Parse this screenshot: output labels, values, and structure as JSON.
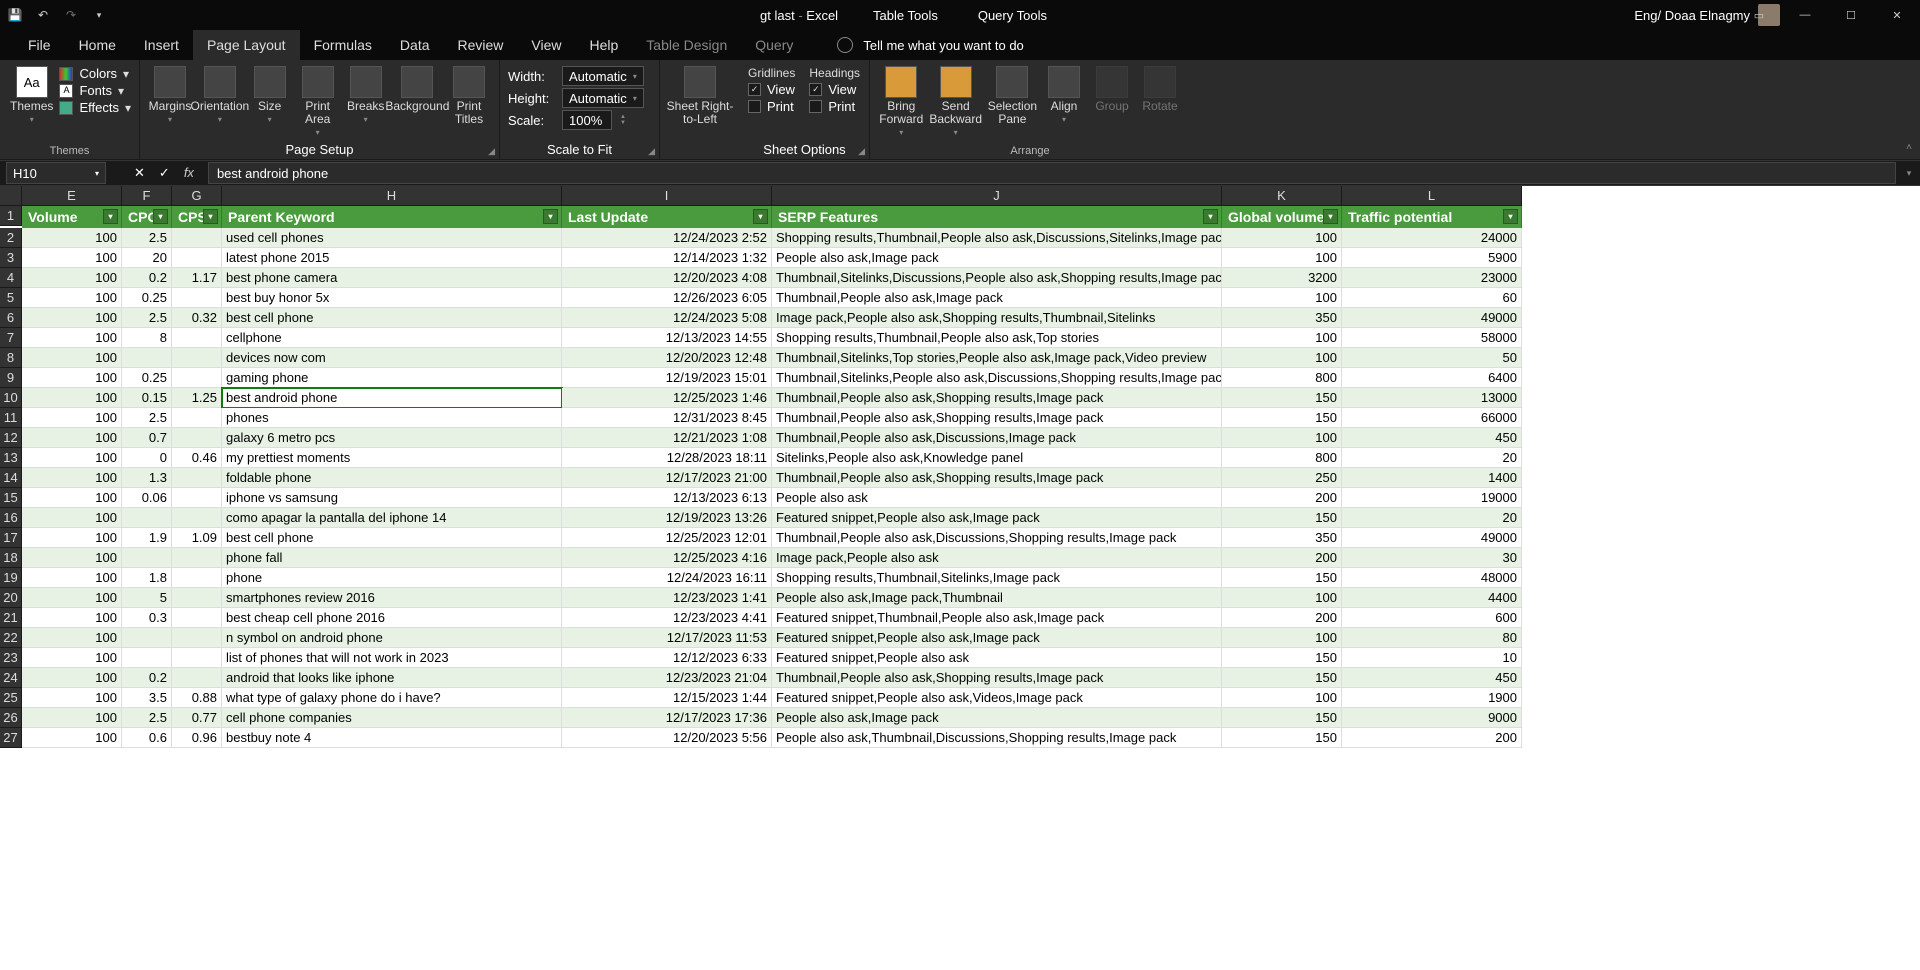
{
  "titlebar": {
    "tool_tabs": [
      "Table Tools",
      "Query Tools"
    ],
    "doc": "gt last",
    "app": "Excel",
    "user": "Eng/ Doaa Elnagmy"
  },
  "tabs": {
    "items": [
      "File",
      "Home",
      "Insert",
      "Page Layout",
      "Formulas",
      "Data",
      "Review",
      "View",
      "Help",
      "Table Design",
      "Query"
    ],
    "active": "Page Layout",
    "dim": [
      "Table Design",
      "Query"
    ],
    "tell_me": "Tell me what you want to do"
  },
  "ribbon": {
    "themes": {
      "label": "Themes",
      "themes": "Themes",
      "colors": "Colors",
      "fonts": "Fonts",
      "effects": "Effects"
    },
    "page_setup": {
      "label": "Page Setup",
      "margins": "Margins",
      "orientation": "Orientation",
      "size": "Size",
      "print_area": "Print\nArea",
      "breaks": "Breaks",
      "background": "Background",
      "print_titles": "Print\nTitles"
    },
    "scale": {
      "label": "Scale to Fit",
      "width": "Width:",
      "height": "Height:",
      "scale": "Scale:",
      "auto": "Automatic",
      "pct": "100%"
    },
    "sheet_rtl": "Sheet Right-\nto-Left",
    "sheet_options": {
      "label": "Sheet Options",
      "gridlines": "Gridlines",
      "headings": "Headings",
      "view": "View",
      "print": "Print"
    },
    "arrange": {
      "label": "Arrange",
      "bring_forward": "Bring\nForward",
      "send_backward": "Send\nBackward",
      "selection_pane": "Selection\nPane",
      "align": "Align",
      "group": "Group",
      "rotate": "Rotate"
    }
  },
  "formula_bar": {
    "cell_ref": "H10",
    "value": "best android phone"
  },
  "columns": [
    "E",
    "F",
    "G",
    "H",
    "I",
    "J",
    "K",
    "L"
  ],
  "headers": [
    "Volume",
    "CPC",
    "CPS",
    "Parent Keyword",
    "Last Update",
    "SERP Features",
    "Global volume",
    "Traffic potential"
  ],
  "rows": [
    {
      "n": 2,
      "vol": 100,
      "cpc": "2.5",
      "cps": "",
      "kw": "used cell phones",
      "upd": "12/24/2023 2:52",
      "serp": "Shopping results,Thumbnail,People also ask,Discussions,Sitelinks,Image pack",
      "gv": 100,
      "tp": 24000
    },
    {
      "n": 3,
      "vol": 100,
      "cpc": "20",
      "cps": "",
      "kw": "latest phone 2015",
      "upd": "12/14/2023 1:32",
      "serp": "People also ask,Image pack",
      "gv": 100,
      "tp": 5900
    },
    {
      "n": 4,
      "vol": 100,
      "cpc": "0.2",
      "cps": "1.17",
      "kw": "best phone camera",
      "upd": "12/20/2023 4:08",
      "serp": "Thumbnail,Sitelinks,Discussions,People also ask,Shopping results,Image pack",
      "gv": 3200,
      "tp": 23000
    },
    {
      "n": 5,
      "vol": 100,
      "cpc": "0.25",
      "cps": "",
      "kw": "best buy honor 5x",
      "upd": "12/26/2023 6:05",
      "serp": "Thumbnail,People also ask,Image pack",
      "gv": 100,
      "tp": 60
    },
    {
      "n": 6,
      "vol": 100,
      "cpc": "2.5",
      "cps": "0.32",
      "kw": "best cell phone",
      "upd": "12/24/2023 5:08",
      "serp": "Image pack,People also ask,Shopping results,Thumbnail,Sitelinks",
      "gv": 350,
      "tp": 49000
    },
    {
      "n": 7,
      "vol": 100,
      "cpc": "8",
      "cps": "",
      "kw": "cellphone",
      "upd": "12/13/2023 14:55",
      "serp": "Shopping results,Thumbnail,People also ask,Top stories",
      "gv": 100,
      "tp": 58000
    },
    {
      "n": 8,
      "vol": 100,
      "cpc": "",
      "cps": "",
      "kw": "devices now com",
      "upd": "12/20/2023 12:48",
      "serp": "Thumbnail,Sitelinks,Top stories,People also ask,Image pack,Video preview",
      "gv": 100,
      "tp": 50
    },
    {
      "n": 9,
      "vol": 100,
      "cpc": "0.25",
      "cps": "",
      "kw": "gaming phone",
      "upd": "12/19/2023 15:01",
      "serp": "Thumbnail,Sitelinks,People also ask,Discussions,Shopping results,Image pack",
      "gv": 800,
      "tp": 6400
    },
    {
      "n": 10,
      "vol": 100,
      "cpc": "0.15",
      "cps": "1.25",
      "kw": "best android phone",
      "upd": "12/25/2023 1:46",
      "serp": "Thumbnail,People also ask,Shopping results,Image pack",
      "gv": 150,
      "tp": 13000,
      "selected": true
    },
    {
      "n": 11,
      "vol": 100,
      "cpc": "2.5",
      "cps": "",
      "kw": "phones",
      "upd": "12/31/2023 8:45",
      "serp": "Thumbnail,People also ask,Shopping results,Image pack",
      "gv": 150,
      "tp": 66000
    },
    {
      "n": 12,
      "vol": 100,
      "cpc": "0.7",
      "cps": "",
      "kw": "galaxy 6 metro pcs",
      "upd": "12/21/2023 1:08",
      "serp": "Thumbnail,People also ask,Discussions,Image pack",
      "gv": 100,
      "tp": 450
    },
    {
      "n": 13,
      "vol": 100,
      "cpc": "0",
      "cps": "0.46",
      "kw": "my prettiest moments",
      "upd": "12/28/2023 18:11",
      "serp": "Sitelinks,People also ask,Knowledge panel",
      "gv": 800,
      "tp": 20
    },
    {
      "n": 14,
      "vol": 100,
      "cpc": "1.3",
      "cps": "",
      "kw": "foldable phone",
      "upd": "12/17/2023 21:00",
      "serp": "Thumbnail,People also ask,Shopping results,Image pack",
      "gv": 250,
      "tp": 1400
    },
    {
      "n": 15,
      "vol": 100,
      "cpc": "0.06",
      "cps": "",
      "kw": "iphone vs samsung",
      "upd": "12/13/2023 6:13",
      "serp": "People also ask",
      "gv": 200,
      "tp": 19000
    },
    {
      "n": 16,
      "vol": 100,
      "cpc": "",
      "cps": "",
      "kw": "como apagar la pantalla del iphone 14",
      "upd": "12/19/2023 13:26",
      "serp": "Featured snippet,People also ask,Image pack",
      "gv": 150,
      "tp": 20
    },
    {
      "n": 17,
      "vol": 100,
      "cpc": "1.9",
      "cps": "1.09",
      "kw": "best cell phone",
      "upd": "12/25/2023 12:01",
      "serp": "Thumbnail,People also ask,Discussions,Shopping results,Image pack",
      "gv": 350,
      "tp": 49000
    },
    {
      "n": 18,
      "vol": 100,
      "cpc": "",
      "cps": "",
      "kw": "phone fall",
      "upd": "12/25/2023 4:16",
      "serp": "Image pack,People also ask",
      "gv": 200,
      "tp": 30
    },
    {
      "n": 19,
      "vol": 100,
      "cpc": "1.8",
      "cps": "",
      "kw": "phone",
      "upd": "12/24/2023 16:11",
      "serp": "Shopping results,Thumbnail,Sitelinks,Image pack",
      "gv": 150,
      "tp": 48000
    },
    {
      "n": 20,
      "vol": 100,
      "cpc": "5",
      "cps": "",
      "kw": "smartphones review 2016",
      "upd": "12/23/2023 1:41",
      "serp": "People also ask,Image pack,Thumbnail",
      "gv": 100,
      "tp": 4400
    },
    {
      "n": 21,
      "vol": 100,
      "cpc": "0.3",
      "cps": "",
      "kw": "best cheap cell phone 2016",
      "upd": "12/23/2023 4:41",
      "serp": "Featured snippet,Thumbnail,People also ask,Image pack",
      "gv": 200,
      "tp": 600
    },
    {
      "n": 22,
      "vol": 100,
      "cpc": "",
      "cps": "",
      "kw": "n symbol on android phone",
      "upd": "12/17/2023 11:53",
      "serp": "Featured snippet,People also ask,Image pack",
      "gv": 100,
      "tp": 80
    },
    {
      "n": 23,
      "vol": 100,
      "cpc": "",
      "cps": "",
      "kw": "list of phones that will not work in 2023",
      "upd": "12/12/2023 6:33",
      "serp": "Featured snippet,People also ask",
      "gv": 150,
      "tp": 10
    },
    {
      "n": 24,
      "vol": 100,
      "cpc": "0.2",
      "cps": "",
      "kw": "android that looks like iphone",
      "upd": "12/23/2023 21:04",
      "serp": "Thumbnail,People also ask,Shopping results,Image pack",
      "gv": 150,
      "tp": 450
    },
    {
      "n": 25,
      "vol": 100,
      "cpc": "3.5",
      "cps": "0.88",
      "kw": "what type of galaxy phone do i have?",
      "upd": "12/15/2023 1:44",
      "serp": "Featured snippet,People also ask,Videos,Image pack",
      "gv": 100,
      "tp": 1900
    },
    {
      "n": 26,
      "vol": 100,
      "cpc": "2.5",
      "cps": "0.77",
      "kw": "cell phone companies",
      "upd": "12/17/2023 17:36",
      "serp": "People also ask,Image pack",
      "gv": 150,
      "tp": 9000
    },
    {
      "n": 27,
      "vol": 100,
      "cpc": "0.6",
      "cps": "0.96",
      "kw": "bestbuy note 4",
      "upd": "12/20/2023 5:56",
      "serp": "People also ask,Thumbnail,Discussions,Shopping results,Image pack",
      "gv": 150,
      "tp": 200
    }
  ]
}
